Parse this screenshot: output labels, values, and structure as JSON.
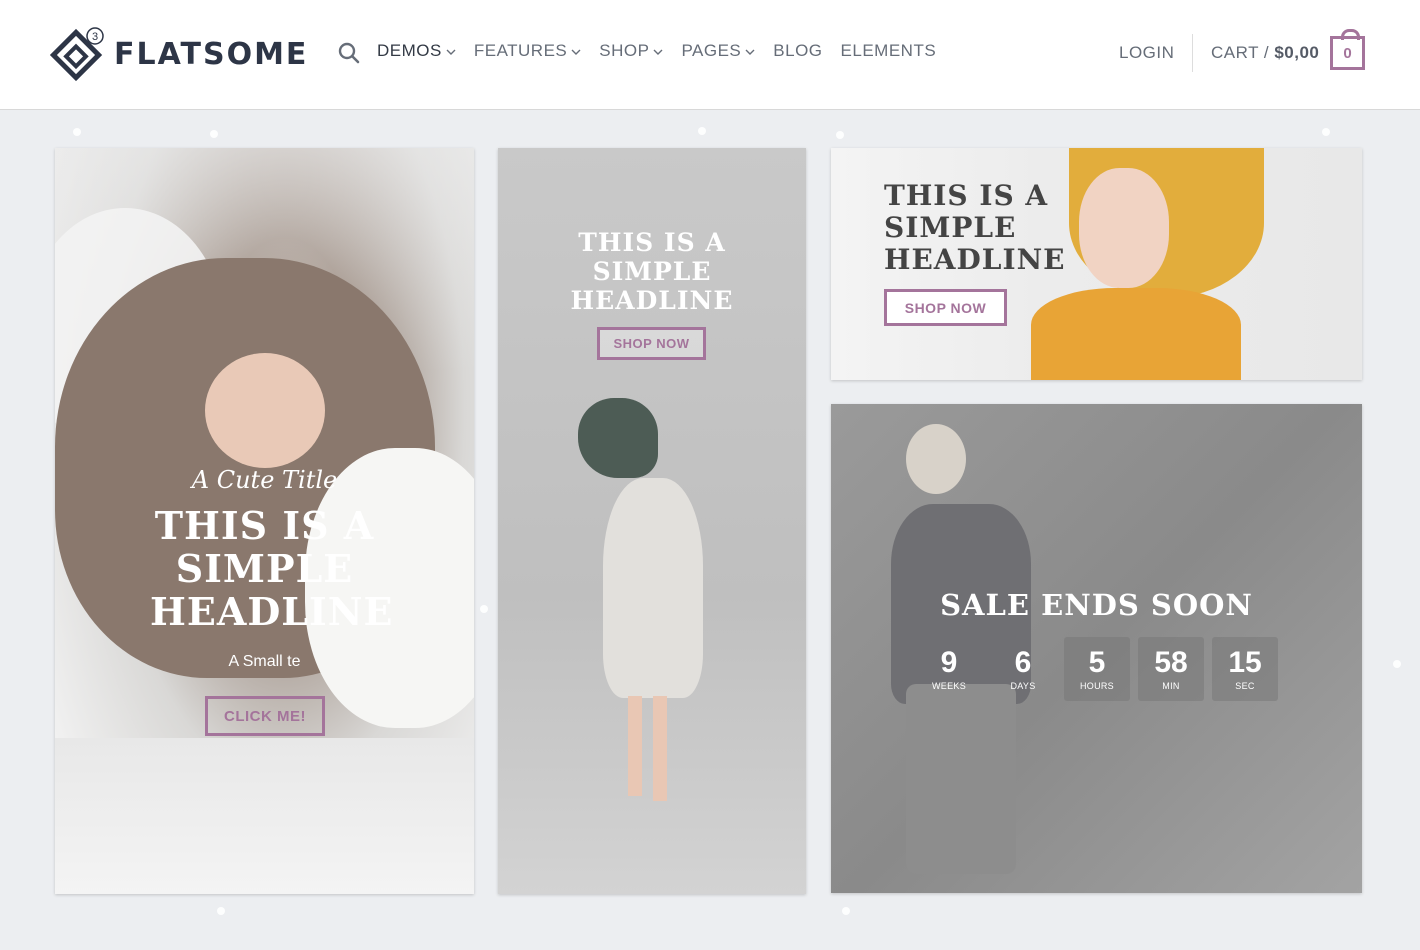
{
  "header": {
    "logo_text": "FLATSOME",
    "logo_badge": "3",
    "nav": [
      {
        "label": "DEMOS",
        "dropdown": true
      },
      {
        "label": "FEATURES",
        "dropdown": true
      },
      {
        "label": "SHOP",
        "dropdown": true
      },
      {
        "label": "PAGES",
        "dropdown": true
      },
      {
        "label": "BLOG",
        "dropdown": false
      },
      {
        "label": "ELEMENTS",
        "dropdown": false
      }
    ],
    "login": "LOGIN",
    "cart_label": "CART /",
    "cart_amount": "$0,00",
    "cart_count": "0"
  },
  "banners": {
    "tall_left": {
      "subtitle": "A Cute Title",
      "headline": "THIS IS A SIMPLE HEADLINE",
      "small_text": "A Small te",
      "button": "CLICK ME!"
    },
    "tall_middle": {
      "headline": "THIS IS A SIMPLE HEADLINE",
      "button": "SHOP NOW"
    },
    "top_right": {
      "headline": "THIS IS A SIMPLE HEADLINE",
      "button": "SHOP NOW"
    },
    "sale": {
      "title": "SALE ENDS SOON",
      "countdown": [
        {
          "value": "9",
          "label": "WEEKS"
        },
        {
          "value": "6",
          "label": "DAYS"
        },
        {
          "value": "5",
          "label": "HOURS"
        },
        {
          "value": "58",
          "label": "MIN"
        },
        {
          "value": "15",
          "label": "SEC"
        }
      ]
    }
  },
  "colors": {
    "accent": "#a4749b",
    "logo": "#2d3546",
    "background": "#eceef1"
  }
}
